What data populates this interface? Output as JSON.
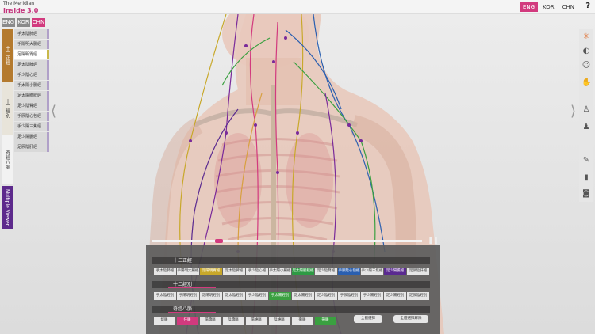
{
  "app": {
    "logo_line1": "The Meridian",
    "logo_line2": "Inside 3.0"
  },
  "top_lang": [
    {
      "label": "ENG",
      "active": true
    },
    {
      "label": "KOR",
      "active": false
    },
    {
      "label": "CHN",
      "active": false
    }
  ],
  "help_label": "?",
  "left_lang": [
    {
      "label": "ENG",
      "active": false
    },
    {
      "label": "KOR",
      "active": false
    },
    {
      "label": "CHN",
      "active": true
    }
  ],
  "side_tabs": [
    "十二正經",
    "十二經別",
    "奇經八脈",
    "Multiple Viewer"
  ],
  "meridians": [
    {
      "label": "手太陰肺經",
      "color": "#b0a0c8"
    },
    {
      "label": "手陽明大腸經",
      "color": "#b0a0c8"
    },
    {
      "label": "足陽明胃經",
      "color": "#c8b84a",
      "selected": true
    },
    {
      "label": "足太陰脾經",
      "color": "#b0a0c8"
    },
    {
      "label": "手少陰心經",
      "color": "#b0a0c8"
    },
    {
      "label": "手太陽小腸經",
      "color": "#b0a0c8"
    },
    {
      "label": "足太陽膀胱經",
      "color": "#b0a0c8"
    },
    {
      "label": "足少陰腎經",
      "color": "#b0a0c8"
    },
    {
      "label": "手厥陰心包經",
      "color": "#b0a0c8"
    },
    {
      "label": "手少陽三焦經",
      "color": "#b0a0c8"
    },
    {
      "label": "足少陽膽經",
      "color": "#b0a0c8"
    },
    {
      "label": "足厥陰肝經",
      "color": "#b0a0c8"
    }
  ],
  "nav": {
    "left": "⟨",
    "right": "⟩"
  },
  "player": {
    "progress": 0.24,
    "pause_label": "❚❚",
    "collapse_label": "﹀"
  },
  "panel": {
    "section1_title": "十二正經",
    "row1": [
      {
        "label": "手太陰肺經",
        "color": "#e6e6e6"
      },
      {
        "label": "手陽明大腸經",
        "color": "#e6e6e6"
      },
      {
        "label": "足陽明胃經",
        "color": "#c8a82a",
        "hl": true
      },
      {
        "label": "足太陰脾經",
        "color": "#e6e6e6"
      },
      {
        "label": "手少陰心經",
        "color": "#e6e6e6"
      },
      {
        "label": "手太陽小腸經",
        "color": "#e6e6e6"
      },
      {
        "label": "足太陽膀胱經",
        "color": "#2e9a44",
        "hl": true
      },
      {
        "label": "足少陰腎經",
        "color": "#e6e6e6"
      },
      {
        "label": "手厥陰心包經",
        "color": "#2a5fb0",
        "hl": true
      },
      {
        "label": "手少陽三焦經",
        "color": "#e6e6e6"
      },
      {
        "label": "足少陽膽經",
        "color": "#5a2a90",
        "hl": true
      },
      {
        "label": "足厥陰肝經",
        "color": "#e6e6e6"
      }
    ],
    "section2_title": "十二經別",
    "row2": [
      {
        "label": "手太陰經別",
        "color": "#e6e6e6"
      },
      {
        "label": "手陽明經別",
        "color": "#e6e6e6"
      },
      {
        "label": "足陽明經別",
        "color": "#e6e6e6"
      },
      {
        "label": "足太陰經別",
        "color": "#e6e6e6"
      },
      {
        "label": "手少陰經別",
        "color": "#e6e6e6"
      },
      {
        "label": "手太陽經別",
        "color": "#3aa040",
        "hl": true
      },
      {
        "label": "足太陽經別",
        "color": "#e6e6e6"
      },
      {
        "label": "足少陰經別",
        "color": "#e6e6e6"
      },
      {
        "label": "手厥陰經別",
        "color": "#e6e6e6"
      },
      {
        "label": "手少陽經別",
        "color": "#e6e6e6"
      },
      {
        "label": "足少陽經別",
        "color": "#e6e6e6"
      },
      {
        "label": "足厥陰經別",
        "color": "#e6e6e6"
      }
    ],
    "section3_title": "奇經八脈",
    "row3": [
      {
        "label": "督脈",
        "color": "#e6e6e6"
      },
      {
        "label": "任脈",
        "color": "#d23a7e",
        "hl": true
      },
      {
        "label": "陽蹻脈",
        "color": "#e6e6e6"
      },
      {
        "label": "陰蹻脈",
        "color": "#e6e6e6"
      },
      {
        "label": "陽維脈",
        "color": "#e6e6e6"
      },
      {
        "label": "陰維脈",
        "color": "#e6e6e6"
      },
      {
        "label": "衝脈",
        "color": "#e6e6e6"
      },
      {
        "label": "帶脈",
        "color": "#3aa040",
        "hl": true
      }
    ],
    "select_all": "全體選擇",
    "deselect_all": "全體選擇解除"
  },
  "right_tools": [
    "acupoint-icon",
    "ear-icon",
    "face-icon",
    "muscle-icon",
    "body-front-icon",
    "body-side-icon",
    "eraser-icon",
    "trash-icon",
    "camera-icon"
  ]
}
